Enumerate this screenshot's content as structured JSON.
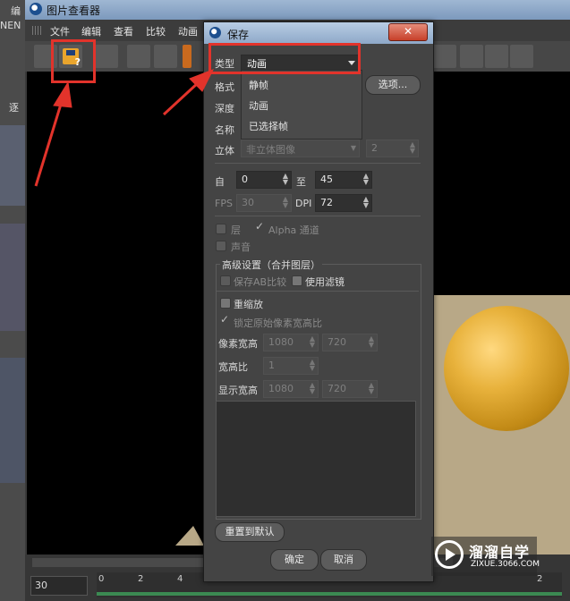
{
  "background_app": {
    "title": "图片查看器",
    "menu": [
      "文件",
      "编辑",
      "查看",
      "比较",
      "动画"
    ],
    "left_fragments": [
      "NEN",
      "编",
      "逐"
    ],
    "timeline": {
      "fps_value": "30",
      "ruler_labels": [
        "0",
        "2",
        "4",
        "2"
      ]
    }
  },
  "dialog": {
    "title": "保存",
    "close_glyph": "✕",
    "type": {
      "label": "类型",
      "selected": "动画",
      "options": [
        "静帧",
        "动画",
        "已选择帧"
      ]
    },
    "format": {
      "label": "格式"
    },
    "options_button": "选项...",
    "depth": {
      "label": "深度"
    },
    "name": {
      "label": "名称"
    },
    "stereo": {
      "label": "立体",
      "value": "非立体图像",
      "count": "2"
    },
    "range": {
      "from_label": "自",
      "from_value": "0",
      "to_label": "至",
      "to_value": "45"
    },
    "fps": {
      "label": "FPS",
      "value": "30"
    },
    "dpi": {
      "label": "DPI",
      "value": "72"
    },
    "layers": {
      "label": "层"
    },
    "alpha": {
      "label": "Alpha 通道"
    },
    "sound": {
      "label": "声音"
    },
    "advanced": {
      "title": "高级设置（合并图层）",
      "save_ab": "保存AB比较",
      "use_filter": "使用滤镜",
      "rescale": "重缩放",
      "lock_aspect": "锁定原始像素宽高比",
      "pixel_size_label": "像素宽高",
      "pixel_w": "1080",
      "pixel_h": "720",
      "aspect_label": "宽高比",
      "aspect_value": "1",
      "display_size_label": "显示宽高",
      "display_w": "1080",
      "display_h": "720"
    },
    "reset_button": "重置到默认",
    "ok_button": "确定",
    "cancel_button": "取消"
  },
  "watermark": {
    "title": "溜溜自学",
    "url": "ZIXUE.3066.COM"
  },
  "colors": {
    "annotation_red": "#e2332b",
    "sphere": "#e8b23c",
    "floor": "#b8a887"
  }
}
